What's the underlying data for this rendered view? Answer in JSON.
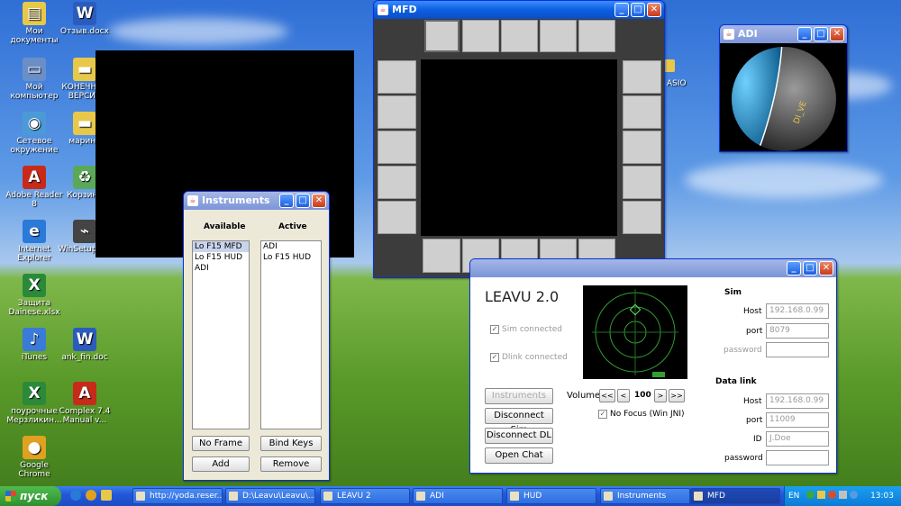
{
  "desktop": {
    "icons": [
      {
        "label": "Мои документы",
        "icon": "folder-docs-icon",
        "color": "#e8c84a"
      },
      {
        "label": "Отзыв.docx",
        "icon": "word-doc-icon",
        "color": "#2b5cbd"
      },
      {
        "label": "Мой компьютер",
        "icon": "computer-icon",
        "color": "#6a8fc8"
      },
      {
        "label": "КОНЕЧНАЯ ВЕРСИЯ",
        "icon": "folder-icon",
        "color": "#e8c84a"
      },
      {
        "label": "Сетевое окружение",
        "icon": "network-icon",
        "color": "#4a9ad8"
      },
      {
        "label": "марина",
        "icon": "folder-icon",
        "color": "#e8c84a"
      },
      {
        "label": "Adobe Reader 8",
        "icon": "pdf-icon",
        "color": "#c82a1a"
      },
      {
        "label": "Корзина",
        "icon": "recycle-bin-icon",
        "color": "#5aa85a"
      },
      {
        "label": "Internet Explorer",
        "icon": "ie-icon",
        "color": "#2a7ad8"
      },
      {
        "label": "WinSetupFr...",
        "icon": "usb-icon",
        "color": "#444444"
      },
      {
        "label": "Защита Dainese.xlsx",
        "icon": "excel-icon",
        "color": "#2a8a3a"
      },
      {
        "label": "iTunes",
        "icon": "itunes-icon",
        "color": "#3a7ad8"
      },
      {
        "label": "ank_fin.doc",
        "icon": "word-doc-icon",
        "color": "#2b5cbd"
      },
      {
        "label": "поурочные Мерзликин...",
        "icon": "excel-icon",
        "color": "#2a8a3a"
      },
      {
        "label": "Complex 7.4 Manual v...",
        "icon": "pdf-icon",
        "color": "#c82a1a"
      },
      {
        "label": "Google Chrome",
        "icon": "chrome-icon",
        "color": "#e0a020"
      }
    ],
    "hidden_label": "ASIO"
  },
  "mfd_window": {
    "title": "MFD"
  },
  "adi_window": {
    "title": "ADI",
    "sphere_text": "DI_VE"
  },
  "instruments_window": {
    "title": "Instruments",
    "available_header": "Available",
    "active_header": "Active",
    "available": [
      "Lo F15 MFD",
      "Lo F15 HUD",
      "ADI"
    ],
    "active": [
      "ADI",
      "Lo F15 HUD"
    ],
    "no_frame_label": "No Frame",
    "bind_keys_label": "Bind Keys",
    "add_label": "Add",
    "remove_label": "Remove"
  },
  "leavu_window": {
    "app_title": "LEAVU 2.0",
    "sim_connected": "Sim connected",
    "dlink_connected": "Dlink connected",
    "instruments_btn": "Instruments",
    "disconnect_sim": "Disconnect Sim",
    "disconnect_dl": "Disconnect DL",
    "open_chat": "Open Chat",
    "volume_label": "Volume",
    "vol_down_fast": "<<",
    "vol_down": "<",
    "volume_value": "100",
    "vol_up": ">",
    "vol_up_fast": ">>",
    "no_focus": "No Focus (Win JNI)",
    "sim_header": "Sim",
    "host_label": "Host",
    "host_value": "192.168.0.99",
    "port_label": "port",
    "port_value": "8079",
    "password_label": "password",
    "datalink_header": "Data link",
    "dl_host_label": "Host",
    "dl_host_value": "192.168.0.99",
    "dl_port_label": "port",
    "dl_port_value": "11009",
    "id_label": "ID",
    "id_value": "J.Doe",
    "dl_password_label": "password"
  },
  "taskbar": {
    "start_label": "пуск",
    "tasks": [
      {
        "label": "http://yoda.reser...",
        "active": false
      },
      {
        "label": "D:\\Leavu\\Leavu\\...",
        "active": false
      },
      {
        "label": "LEAVU 2",
        "active": false
      },
      {
        "label": "ADI",
        "active": false
      },
      {
        "label": "HUD",
        "active": false
      },
      {
        "label": "Instruments",
        "active": false
      },
      {
        "label": "MFD",
        "active": true
      }
    ],
    "lang": "EN",
    "clock": "13:03"
  },
  "colors": {
    "accent": "#0c5fe0",
    "sphere_blue": "#35a8e0",
    "radar_green": "#2fa030"
  }
}
